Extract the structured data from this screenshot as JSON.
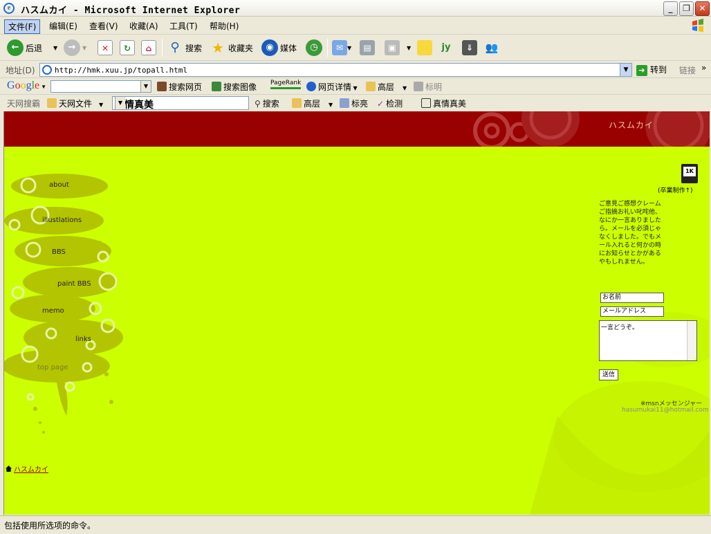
{
  "window": {
    "title": "ハスムカイ - Microsoft Internet Explorer",
    "min": "_",
    "max": "❐",
    "close": "✕"
  },
  "menu": [
    "文件(F)",
    "编辑(E)",
    "查看(V)",
    "收藏(A)",
    "工具(T)",
    "帮助(H)"
  ],
  "toolbar": {
    "back": "后退",
    "search": "搜索",
    "favorites": "收藏夹",
    "media": "媒体"
  },
  "address": {
    "label": "地址(D)",
    "url": "http://hmk.xuu.jp/topall.html",
    "go": "转到",
    "links": "链接"
  },
  "google": {
    "logo": "Google",
    "search_web": "搜索网页",
    "search_images": "搜索图像",
    "pagerank": "PageRank",
    "page_info": "网页详情",
    "up": "高层",
    "highlight": "标明"
  },
  "tianwang": {
    "label": "天网搜霸",
    "file": "天网文件",
    "query": "真情真美",
    "search": "搜索",
    "up": "高层",
    "highlight": "标亮",
    "detect": "检测",
    "query_btn": "真情真美"
  },
  "site": {
    "banner_title": "ハスムカイ",
    "nav": [
      "about",
      "illustlations",
      "BBS",
      "paint BBS",
      "memo",
      "links",
      "top page"
    ],
    "home_link": "ハスムカイ",
    "book_badge": "1K",
    "book_caption": "(卒業制作↑)",
    "feedback_text": "ご意見ご感想クレームご指摘お礼い叱咤他、なにか一言ありましたら。メールを必須じゃなくしました。でもメール入れると何かの時にお知らせとかがあるやもしれません。",
    "name_field": "お名前",
    "email_field": "メールアドレス",
    "comment_field": "一言どうぞ。",
    "submit": "送信",
    "msn_label": "※msnメッセンジャー",
    "msn_email": "hasumukai11@hotmail.com"
  },
  "status": "包括使用所选项的命令。",
  "colors": {
    "banner": "#990000",
    "page_bg": "#ccff00",
    "blob": "#b3c400",
    "link": "#990000"
  }
}
